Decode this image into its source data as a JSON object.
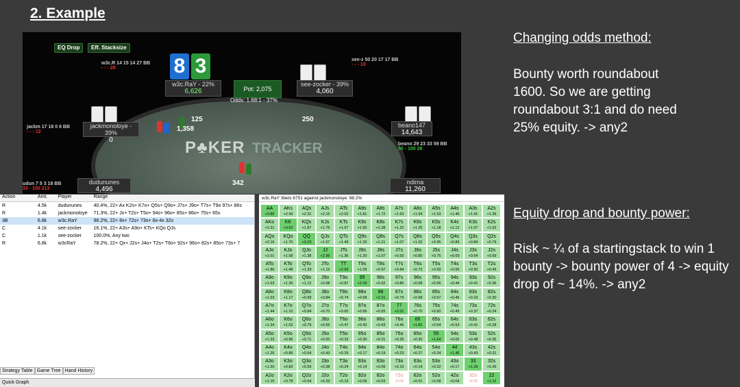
{
  "slide": {
    "title": "2. Example"
  },
  "table": {
    "buttons": [
      "EQ Drop",
      "Eff. Stacksize"
    ],
    "hero_cards": [
      "8",
      "3"
    ],
    "pot": "Pot: 2,075",
    "odds": "Odds: 1.68:1 - 37%",
    "logo_a": "P♣KER",
    "logo_b": "TRACKER",
    "players": [
      {
        "name": "w3c.RaY - 22%",
        "stack": "6,626"
      },
      {
        "name": "see-zocker - 39%",
        "stack": "4,060"
      },
      {
        "name": "jackmonoloye - 39%",
        "stack": "0"
      },
      {
        "name": "beano147",
        "stack": "14,643"
      },
      {
        "name": "dudununes",
        "stack": "4,496"
      },
      {
        "name": "ndima",
        "stack": "11,260"
      }
    ],
    "huds": [
      {
        "a": "w3c.R 14 15 14 27 BB",
        "b": "- - - 28"
      },
      {
        "a": "see-z 50 20 17 17 BB",
        "b": "- - - 10"
      },
      {
        "a": "jackm 17 18 0 6 BB",
        "b": "- - - 12"
      },
      {
        "a": "beano 29 23 33 59 BB",
        "b": "50 - 100 28"
      },
      {
        "a": "udun 7 5 3 18 BB",
        "b": "33 - 100 213"
      }
    ],
    "bets": [
      "125",
      "1,358",
      "250",
      "342"
    ]
  },
  "strategy": {
    "headers": [
      "Action",
      "Amt.",
      "Player",
      "Range"
    ],
    "rows": [
      {
        "action": "R",
        "amt": "4.5k",
        "player": "dudununes",
        "range": "40.4%, 22+ Ax K2s+ K7o+ Q5s+ Q9o+ J7s+ J9o+ T7s+ T9o 97s+ 86s"
      },
      {
        "action": "R",
        "amt": "1.4k",
        "player": "jackmonoloye",
        "range": "71.3%, 22+ Jx+ T2s+ T5o+ 94s+ 96o+ 85s+ 86o+ 75s+ 65s"
      },
      {
        "action": "3B",
        "amt": "6.8k",
        "player": "w3c.RaY",
        "range": "98.2%, 22+ 8x+ 72s+ 73o+ 6x-4x 32s"
      },
      {
        "action": "C",
        "amt": "4.1k",
        "player": "see-zocker",
        "range": "16.1%, 22+ A3s+ A9o+ KTs+ KQo QJs"
      },
      {
        "action": "C",
        "amt": "1.1k",
        "player": "see-zocker",
        "range": "100.0%, Any two"
      },
      {
        "action": "R",
        "amt": "6.8k",
        "player": "w3cRaY",
        "range": "78.2%, 22+ Qx+ J2s+ J4o+ T2s+ T6o+ 92s+ 96o+ 82s+ 85o+ 73s+ 7"
      }
    ],
    "tabs": [
      "Strategy Table",
      "Game Tree",
      "Hand History"
    ],
    "quick_graph": "Quick Graph"
  },
  "grid": {
    "title": "w3c.RaY 3bets 6751 against jackmonoloye: 98.2%",
    "cells": [
      [
        "AA",
        "+3.86",
        "AKs",
        "+2.43",
        "AQs",
        "+2.31",
        "AJs",
        "+2.16",
        "ATs",
        "+2.02",
        "A9s",
        "+1.81",
        "A8s",
        "+1.72",
        "A7s",
        "+1.63",
        "A6s",
        "+1.54",
        "A5s",
        "+1.53",
        "A4s",
        "+1.46",
        "A3s",
        "+1.41",
        "A2s",
        "+1.36"
      ],
      [
        "AKo",
        "+2.31",
        "KK",
        "+3.52",
        "KQs",
        "+1.87",
        "KJs",
        "+1.76",
        "KTs",
        "+1.67",
        "K9s",
        "+1.50",
        "K8s",
        "+1.38",
        "K7s",
        "+1.32",
        "K6s",
        "+1.25",
        "K5s",
        "+1.18",
        "K4s",
        "+1.12",
        "K3s",
        "+1.07",
        "K2s",
        "+1.02"
      ],
      [
        "AQo",
        "+2.16",
        "KQo",
        "+1.70",
        "QQ",
        "+3.23",
        "QJs",
        "+1.57",
        "QTs",
        "+1.49",
        "Q9s",
        "+1.33",
        "Q8s",
        "+1.21",
        "Q7s",
        "+1.07",
        "Q6s",
        "+1.02",
        "Q5s",
        "+0.95",
        "Q4s",
        "+0.89",
        "Q3s",
        "+0.84",
        "Q2s",
        "+0.79"
      ],
      [
        "AJo",
        "+2.01",
        "KJo",
        "+1.58",
        "QJo",
        "+1.38",
        "JJ",
        "+2.95",
        "JTs",
        "+1.36",
        "J9s",
        "+1.20",
        "J8s",
        "+1.07",
        "J7s",
        "+0.93",
        "J6s",
        "+0.80",
        "J5s",
        "+0.75",
        "J4s",
        "+0.69",
        "J3s",
        "+0.64",
        "J2s",
        "+0.59"
      ],
      [
        "ATo",
        "+1.86",
        "KTo",
        "+1.48",
        "QTo",
        "+1.29",
        "JTo",
        "+1.15",
        "TT",
        "+2.69",
        "T9s",
        "+1.09",
        "T8s",
        "+0.97",
        "T7s",
        "+0.84",
        "T6s",
        "+0.72",
        "T5s",
        "+0.59",
        "T4s",
        "+0.55",
        "T3s",
        "+0.50",
        "T2s",
        "+0.45"
      ],
      [
        "A9o",
        "+1.63",
        "K9o",
        "+1.30",
        "Q9o",
        "+1.12",
        "J9o",
        "+0.98",
        "T9o",
        "+0.87",
        "99",
        "+2.43",
        "98s",
        "+0.92",
        "97s",
        "+0.80",
        "96s",
        "+0.68",
        "95s",
        "+0.56",
        "94s",
        "+0.44",
        "93s",
        "+0.41",
        "92s",
        "+0.36"
      ],
      [
        "A8o",
        "+1.53",
        "K8o",
        "+1.17",
        "Q8o",
        "+0.99",
        "J8o",
        "+0.84",
        "T8o",
        "+0.74",
        "98o",
        "+0.68",
        "88",
        "+2.21",
        "87s",
        "+0.79",
        "86s",
        "+0.68",
        "85s",
        "+0.57",
        "84s",
        "+0.45",
        "83s",
        "+0.33",
        "82s",
        "+0.30"
      ],
      [
        "A7o",
        "+1.44",
        "K7o",
        "+1.10",
        "Q7o",
        "+0.84",
        "J7o",
        "+0.70",
        "T7o",
        "+0.60",
        "97o",
        "+0.56",
        "87o",
        "+0.55",
        "77",
        "+2.01",
        "76s",
        "+0.70",
        "75s",
        "+0.60",
        "74s",
        "+0.49",
        "73s",
        "+0.37",
        "72s",
        "+0.24"
      ],
      [
        "A6o",
        "+1.34",
        "K6o",
        "+1.03",
        "Q6o",
        "+0.79",
        "J6o",
        "+0.55",
        "T6o",
        "+0.47",
        "96o",
        "+0.43",
        "86o",
        "+0.43",
        "76o",
        "+0.46",
        "66",
        "+1.82",
        "65s",
        "+0.64",
        "64s",
        "+0.53",
        "63s",
        "+0.41",
        "62s",
        "+0.28"
      ],
      [
        "A5o",
        "+1.33",
        "K5o",
        "+0.96",
        "Q5o",
        "+0.71",
        "J5o",
        "+0.50",
        "T5o",
        "+0.33",
        "95o",
        "+0.30",
        "85o",
        "+0.31",
        "75o",
        "+0.35",
        "65o",
        "+0.30",
        "55",
        "+1.64",
        "54s",
        "+0.60",
        "53s",
        "+0.48",
        "52s",
        "+0.35"
      ],
      [
        "A4o",
        "+1.26",
        "K4o",
        "+0.89",
        "Q4o",
        "+0.64",
        "J4o",
        "+0.43",
        "T4o",
        "+0.29",
        "94o",
        "+0.17",
        "84o",
        "+0.19",
        "74o",
        "+0.23",
        "64o",
        "+0.27",
        "54o",
        "+0.34",
        "44",
        "+1.46",
        "43s",
        "+0.43",
        "42s",
        "+0.31"
      ],
      [
        "A3o",
        "+1.20",
        "K3o",
        "+0.83",
        "Q3o",
        "+0.59",
        "J3o",
        "+0.38",
        "T3o",
        "+0.24",
        "93o",
        "+0.14",
        "83o",
        "+0.06",
        "73o",
        "+0.10",
        "63o",
        "+0.14",
        "53o",
        "+0.22",
        "43o",
        "+0.17",
        "33",
        "+1.29",
        "32s",
        "+0.26"
      ],
      [
        "A2o",
        "+1.15",
        "K2o",
        "+0.78",
        "Q2o",
        "+0.54",
        "J2o",
        "+0.33",
        "T2o",
        "+0.19",
        "92o",
        "+0.09",
        "82o",
        "+0.03",
        "72o",
        "-0.04",
        "62o",
        "+0.01",
        "52o",
        "+0.08",
        "42o",
        "+0.04",
        "32o",
        "-0.02",
        "22",
        "+1.12"
      ]
    ]
  },
  "notes": {
    "h1": "Changing odds method:",
    "p1": "Bounty worth roundabout 1600. So we are getting roundabout 3:1 and do need 25% equity. -> any2",
    "h2": "Equity drop and bounty power:",
    "p2": "Risk ~ ¼ of a startingstack to win 1 bounty -> bounty power of 4 -> equity drop of ~ 14%. -> any2"
  },
  "colors": {
    "card_blue": "#1e6fd0",
    "card_green": "#2c9a3a",
    "grid_green": "#a8e0a8",
    "grid_pair": "#6ed06e"
  }
}
